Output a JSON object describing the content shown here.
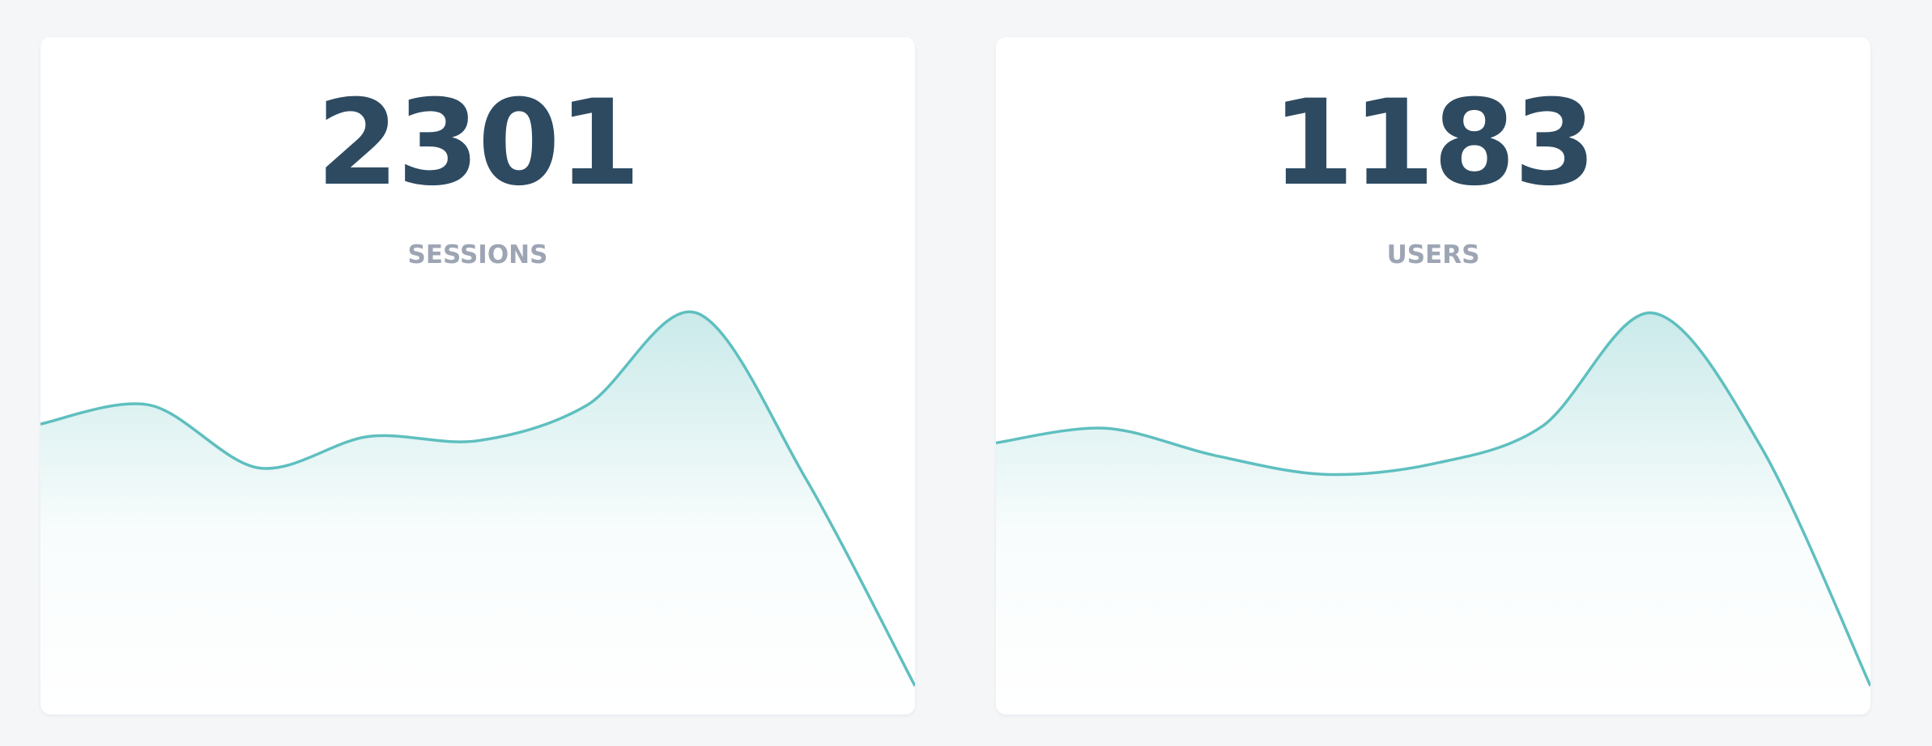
{
  "colors": {
    "page_background": "#f4f6f8",
    "card_background": "#ffffff",
    "value_text": "#2d4a61",
    "label_text": "#9da5b4",
    "line": "#5fbfbf",
    "fill": "#5fbfbf"
  },
  "cards": [
    {
      "value": "2301",
      "label": "SESSIONS",
      "chart_data": {
        "type": "area",
        "x": [
          0,
          1,
          2,
          3,
          4,
          5,
          6,
          7,
          8
        ],
        "values": [
          0.47,
          0.56,
          0.26,
          0.41,
          0.39,
          0.56,
          1.0,
          0.21,
          -0.78
        ],
        "ylim": [
          -0.8,
          1.35
        ],
        "grid": false,
        "legend": "none"
      }
    },
    {
      "value": "1183",
      "label": "USERS",
      "chart_data": {
        "type": "area",
        "x": [
          0,
          1,
          2,
          3,
          4,
          5,
          6,
          7,
          8
        ],
        "values": [
          0.38,
          0.45,
          0.32,
          0.23,
          0.28,
          0.46,
          1.0,
          0.36,
          -0.78
        ],
        "ylim": [
          -0.8,
          1.35
        ],
        "grid": false,
        "legend": "none"
      }
    }
  ]
}
